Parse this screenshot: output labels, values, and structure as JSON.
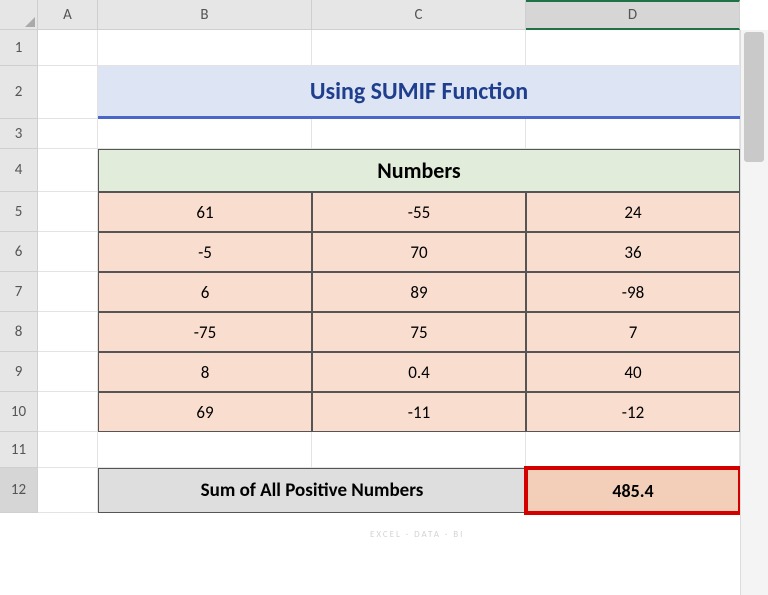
{
  "columns": [
    "A",
    "B",
    "C",
    "D"
  ],
  "rows": [
    "1",
    "2",
    "3",
    "4",
    "5",
    "6",
    "7",
    "8",
    "9",
    "10",
    "11",
    "12"
  ],
  "title": "Using SUMIF Function",
  "table_header": "Numbers",
  "data": [
    [
      "61",
      "-55",
      "24"
    ],
    [
      "-5",
      "70",
      "36"
    ],
    [
      "6",
      "89",
      "-98"
    ],
    [
      "-75",
      "75",
      "7"
    ],
    [
      "8",
      "0.4",
      "40"
    ],
    [
      "69",
      "-11",
      "-12"
    ]
  ],
  "sum_label": "Sum of All Positive Numbers",
  "sum_value": "485.4",
  "chart_data": {
    "type": "table",
    "title": "Numbers",
    "columns": [
      "B",
      "C",
      "D"
    ],
    "rows": [
      [
        61,
        -55,
        24
      ],
      [
        -5,
        70,
        36
      ],
      [
        6,
        89,
        -98
      ],
      [
        -75,
        75,
        7
      ],
      [
        8,
        0.4,
        40
      ],
      [
        69,
        -11,
        -12
      ]
    ],
    "sum_of_positive": 485.4
  }
}
